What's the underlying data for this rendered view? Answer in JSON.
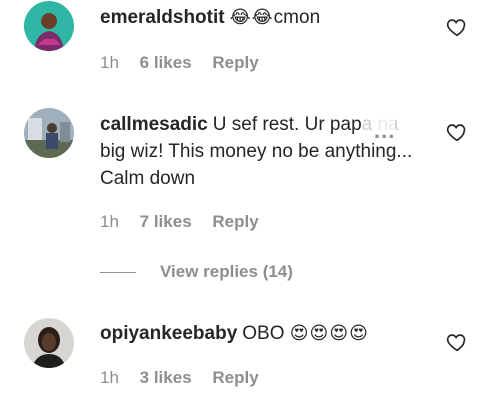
{
  "comments": [
    {
      "username": "emeraldshotit",
      "text": "cmon",
      "emoji": "😂😂",
      "time": "1h",
      "likes": "6 likes",
      "reply": "Reply"
    },
    {
      "username": "callmesadic",
      "text_visible": "U sef rest. Ur pap",
      "text_faded": "a na",
      "more": "...",
      "text_rest": "big wiz! This money no be anything... Calm down",
      "time": "1h",
      "likes": "7 likes",
      "reply": "Reply"
    },
    {
      "username": "opiyankeebaby",
      "text": "OBO",
      "emoji": "😍😍😍😍",
      "time": "1h",
      "likes": "3 likes",
      "reply": "Reply"
    }
  ],
  "view_replies": "View replies (14)",
  "colors": {
    "text": "#262626",
    "secondary": "#8e8e8e",
    "background": "#ffffff"
  },
  "icons": {
    "like": "heart-outline-icon",
    "more": "more-options-icon"
  }
}
